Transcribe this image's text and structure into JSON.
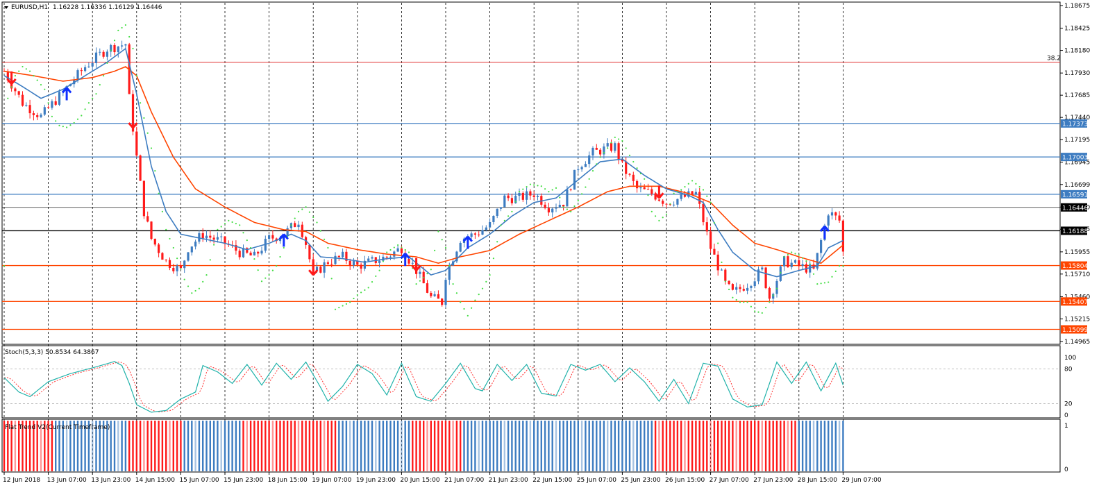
{
  "header": {
    "symbol": "EURUSD,H1",
    "ohlc": "1.16228 1.16336 1.16129 1.16446"
  },
  "price_axis": {
    "ticks": [
      "1.18675",
      "1.18425",
      "1.18180",
      "1.17930",
      "1.17685",
      "1.17440",
      "1.17195",
      "1.16945",
      "1.16699",
      "1.16450",
      "1.16205",
      "1.15955",
      "1.15710",
      "1.15460",
      "1.15215",
      "1.14965"
    ]
  },
  "levels": [
    {
      "label": "1.17373",
      "price": 1.17373,
      "color": "#3d7cc1",
      "boxed": true
    },
    {
      "label": "1.17003",
      "price": 1.17003,
      "color": "#3d7cc1",
      "boxed": true
    },
    {
      "label": "1.16591",
      "price": 1.16591,
      "color": "#3d7cc1",
      "boxed": true
    },
    {
      "label": "1.16446",
      "price": 1.16446,
      "color": "#000000",
      "boxed": true,
      "current": true
    },
    {
      "label": "1.16188",
      "price": 1.16188,
      "color": "#000000",
      "boxed": true
    },
    {
      "label": "1.15804",
      "price": 1.15804,
      "color": "#ff4500",
      "boxed": true
    },
    {
      "label": "1.15407",
      "price": 1.15407,
      "color": "#ff4500",
      "boxed": true
    },
    {
      "label": "1.15099",
      "price": 1.15099,
      "color": "#ff4500",
      "boxed": true
    }
  ],
  "fib": {
    "label": "38.2",
    "price": 1.1805,
    "color": "#e03030"
  },
  "stoch": {
    "title": "Stoch(5,3,3) 50.8534 64.3867",
    "ticks": [
      "100",
      "80",
      "20",
      "0"
    ]
  },
  "flat_trend": {
    "title": "Flat Trend V2(Current Timeframe)",
    "ticks": [
      "1",
      "0"
    ]
  },
  "time_axis": {
    "labels": [
      "12 Jun 2018",
      "13 Jun 07:00",
      "13 Jun 23:00",
      "14 Jun 15:00",
      "15 Jun 07:00",
      "15 Jun 23:00",
      "18 Jun 15:00",
      "19 Jun 07:00",
      "19 Jun 23:00",
      "20 Jun 15:00",
      "21 Jun 07:00",
      "21 Jun 23:00",
      "22 Jun 15:00",
      "25 Jun 07:00",
      "25 Jun 23:00",
      "26 Jun 15:00",
      "27 Jun 07:00",
      "27 Jun 23:00",
      "28 Jun 15:00",
      "29 Jun 07:00"
    ]
  },
  "colors": {
    "bull": "#3d7cc1",
    "bear": "#ff1a1a",
    "ma_fast": "#3d7cc1",
    "ma_slow": "#ff4500",
    "sar": "#44dd44",
    "stoch_main": "#20b2aa",
    "stoch_signal": "#ff3030",
    "arrow_up": "#1030ff",
    "arrow_down": "#ff1a1a",
    "trend_up": "#3d7cc1",
    "trend_down": "#ff1a1a"
  },
  "chart_data": {
    "type": "candlestick",
    "close_path": [
      [
        0,
        1.1795
      ],
      [
        5,
        1.176
      ],
      [
        10,
        1.1745
      ],
      [
        16,
        1.1772
      ],
      [
        22,
        1.18
      ],
      [
        28,
        1.182
      ],
      [
        33,
        1.1825
      ],
      [
        34,
        1.1765
      ],
      [
        36,
        1.17
      ],
      [
        38,
        1.164
      ],
      [
        40,
        1.161
      ],
      [
        44,
        1.1585
      ],
      [
        48,
        1.1575
      ],
      [
        50,
        1.16
      ],
      [
        54,
        1.1615
      ],
      [
        60,
        1.1605
      ],
      [
        64,
        1.1595
      ],
      [
        68,
        1.159
      ],
      [
        72,
        1.161
      ],
      [
        76,
        1.1615
      ],
      [
        80,
        1.163
      ],
      [
        82,
        1.1605
      ],
      [
        84,
        1.157
      ],
      [
        88,
        1.1585
      ],
      [
        92,
        1.159
      ],
      [
        96,
        1.158
      ],
      [
        100,
        1.1585
      ],
      [
        104,
        1.159
      ],
      [
        108,
        1.16
      ],
      [
        112,
        1.1575
      ],
      [
        116,
        1.1545
      ],
      [
        119,
        1.154
      ],
      [
        120,
        1.157
      ],
      [
        124,
        1.161
      ],
      [
        128,
        1.1615
      ],
      [
        132,
        1.1625
      ],
      [
        136,
        1.1655
      ],
      [
        140,
        1.1655
      ],
      [
        144,
        1.166
      ],
      [
        148,
        1.1645
      ],
      [
        152,
        1.165
      ],
      [
        156,
        1.169
      ],
      [
        160,
        1.1705
      ],
      [
        164,
        1.171
      ],
      [
        166,
        1.1712
      ],
      [
        168,
        1.169
      ],
      [
        172,
        1.1665
      ],
      [
        176,
        1.166
      ],
      [
        180,
        1.165
      ],
      [
        184,
        1.1655
      ],
      [
        188,
        1.166
      ],
      [
        192,
        1.16
      ],
      [
        196,
        1.156
      ],
      [
        198,
        1.155
      ],
      [
        202,
        1.156
      ],
      [
        206,
        1.1575
      ],
      [
        208,
        1.1545
      ],
      [
        212,
        1.1585
      ],
      [
        216,
        1.158
      ],
      [
        220,
        1.1575
      ],
      [
        224,
        1.164
      ],
      [
        227,
        1.163
      ],
      [
        228,
        1.1595
      ]
    ],
    "ma_fast_path": [
      [
        0,
        1.179
      ],
      [
        5,
        1.1778
      ],
      [
        10,
        1.1765
      ],
      [
        16,
        1.1775
      ],
      [
        22,
        1.179
      ],
      [
        28,
        1.1805
      ],
      [
        33,
        1.182
      ],
      [
        36,
        1.177
      ],
      [
        40,
        1.169
      ],
      [
        44,
        1.164
      ],
      [
        48,
        1.1615
      ],
      [
        54,
        1.161
      ],
      [
        60,
        1.1605
      ],
      [
        66,
        1.1598
      ],
      [
        72,
        1.1605
      ],
      [
        78,
        1.1615
      ],
      [
        82,
        1.1608
      ],
      [
        86,
        1.159
      ],
      [
        92,
        1.1588
      ],
      [
        98,
        1.1584
      ],
      [
        104,
        1.1588
      ],
      [
        110,
        1.159
      ],
      [
        116,
        1.157
      ],
      [
        120,
        1.1575
      ],
      [
        126,
        1.16
      ],
      [
        132,
        1.1615
      ],
      [
        138,
        1.1635
      ],
      [
        144,
        1.165
      ],
      [
        150,
        1.1655
      ],
      [
        156,
        1.1675
      ],
      [
        162,
        1.1695
      ],
      [
        168,
        1.1698
      ],
      [
        174,
        1.168
      ],
      [
        180,
        1.1665
      ],
      [
        186,
        1.1658
      ],
      [
        190,
        1.165
      ],
      [
        194,
        1.162
      ],
      [
        198,
        1.1595
      ],
      [
        204,
        1.1575
      ],
      [
        210,
        1.1568
      ],
      [
        216,
        1.1575
      ],
      [
        221,
        1.158
      ],
      [
        224,
        1.16
      ],
      [
        228,
        1.1608
      ]
    ],
    "ma_slow_path": [
      [
        0,
        1.1795
      ],
      [
        8,
        1.179
      ],
      [
        16,
        1.1784
      ],
      [
        24,
        1.1788
      ],
      [
        30,
        1.1795
      ],
      [
        33,
        1.18
      ],
      [
        36,
        1.179
      ],
      [
        40,
        1.175
      ],
      [
        46,
        1.17
      ],
      [
        52,
        1.1665
      ],
      [
        60,
        1.1645
      ],
      [
        68,
        1.1628
      ],
      [
        76,
        1.162
      ],
      [
        82,
        1.1618
      ],
      [
        88,
        1.1605
      ],
      [
        96,
        1.1598
      ],
      [
        104,
        1.1593
      ],
      [
        112,
        1.159
      ],
      [
        118,
        1.1583
      ],
      [
        124,
        1.159
      ],
      [
        132,
        1.1597
      ],
      [
        140,
        1.1615
      ],
      [
        148,
        1.163
      ],
      [
        156,
        1.1645
      ],
      [
        164,
        1.1662
      ],
      [
        170,
        1.1668
      ],
      [
        178,
        1.1668
      ],
      [
        186,
        1.166
      ],
      [
        192,
        1.165
      ],
      [
        198,
        1.1625
      ],
      [
        204,
        1.1605
      ],
      [
        210,
        1.1598
      ],
      [
        216,
        1.159
      ],
      [
        222,
        1.1583
      ],
      [
        228,
        1.1603
      ]
    ],
    "sar_points": [
      [
        1,
        1.1765
      ],
      [
        3,
        1.179
      ],
      [
        5,
        1.18
      ],
      [
        7,
        1.1795
      ],
      [
        9,
        1.1785
      ],
      [
        11,
        1.1775
      ],
      [
        13,
        1.1745
      ],
      [
        15,
        1.1735
      ],
      [
        17,
        1.1733
      ],
      [
        19,
        1.1738
      ],
      [
        21,
        1.1746
      ],
      [
        23,
        1.176
      ],
      [
        25,
        1.177
      ],
      [
        27,
        1.179
      ],
      [
        29,
        1.1818
      ],
      [
        31,
        1.184
      ],
      [
        33,
        1.1846
      ],
      [
        35,
        1.182
      ],
      [
        37,
        1.176
      ],
      [
        40,
        1.171
      ],
      [
        42,
        1.166
      ],
      [
        44,
        1.162
      ],
      [
        46,
        1.16
      ],
      [
        49,
        1.1565
      ],
      [
        51,
        1.155
      ],
      [
        53,
        1.1555
      ],
      [
        55,
        1.157
      ],
      [
        58,
        1.162
      ],
      [
        61,
        1.163
      ],
      [
        64,
        1.1625
      ],
      [
        67,
        1.16
      ],
      [
        70,
        1.1563
      ],
      [
        72,
        1.157
      ],
      [
        74,
        1.158
      ],
      [
        76,
        1.16
      ],
      [
        78,
        1.1625
      ],
      [
        80,
        1.164
      ],
      [
        82,
        1.1645
      ],
      [
        85,
        1.1628
      ],
      [
        88,
        1.16
      ],
      [
        90,
        1.1532
      ],
      [
        92,
        1.1536
      ],
      [
        94,
        1.154
      ],
      [
        96,
        1.1548
      ],
      [
        99,
        1.1556
      ],
      [
        102,
        1.1575
      ],
      [
        104,
        1.1595
      ],
      [
        107,
        1.1603
      ],
      [
        110,
        1.1595
      ],
      [
        112,
        1.156
      ],
      [
        114,
        1.1567
      ],
      [
        116,
        1.1576
      ],
      [
        118,
        1.1618
      ],
      [
        120,
        1.16
      ],
      [
        122,
        1.156
      ],
      [
        124,
        1.154
      ],
      [
        126,
        1.1525
      ],
      [
        128,
        1.1542
      ],
      [
        130,
        1.1555
      ],
      [
        132,
        1.157
      ],
      [
        135,
        1.1625
      ],
      [
        138,
        1.164
      ],
      [
        140,
        1.1662
      ],
      [
        143,
        1.167
      ],
      [
        146,
        1.1668
      ],
      [
        148,
        1.1662
      ],
      [
        150,
        1.1666
      ],
      [
        152,
        1.1645
      ],
      [
        154,
        1.164
      ],
      [
        156,
        1.1652
      ],
      [
        158,
        1.1667
      ],
      [
        160,
        1.1685
      ],
      [
        162,
        1.17
      ],
      [
        164,
        1.171
      ],
      [
        166,
        1.1722
      ],
      [
        168,
        1.1718
      ],
      [
        170,
        1.1702
      ],
      [
        172,
        1.1688
      ],
      [
        174,
        1.1676
      ],
      [
        176,
        1.164
      ],
      [
        178,
        1.163
      ],
      [
        180,
        1.1637
      ],
      [
        182,
        1.166
      ],
      [
        184,
        1.1664
      ],
      [
        187,
        1.1674
      ],
      [
        190,
        1.1664
      ],
      [
        192,
        1.165
      ],
      [
        194,
        1.1605
      ],
      [
        196,
        1.1563
      ],
      [
        198,
        1.1545
      ],
      [
        200,
        1.154
      ],
      [
        202,
        1.154
      ],
      [
        204,
        1.153
      ],
      [
        206,
        1.1528
      ],
      [
        208,
        1.154
      ],
      [
        210,
        1.1555
      ],
      [
        212,
        1.159
      ],
      [
        214,
        1.1595
      ],
      [
        216,
        1.1592
      ],
      [
        219,
        1.1582
      ],
      [
        221,
        1.156
      ],
      [
        224,
        1.1562
      ],
      [
        227,
        1.158
      ]
    ],
    "arrows": [
      {
        "i": 2,
        "dir": "down"
      },
      {
        "i": 17,
        "dir": "up"
      },
      {
        "i": 35,
        "dir": "down"
      },
      {
        "i": 76,
        "dir": "up"
      },
      {
        "i": 84,
        "dir": "down"
      },
      {
        "i": 109,
        "dir": "up"
      },
      {
        "i": 112,
        "dir": "down"
      },
      {
        "i": 126,
        "dir": "up"
      },
      {
        "i": 178,
        "dir": "down"
      },
      {
        "i": 223,
        "dir": "up"
      }
    ],
    "stoch_path": [
      [
        0,
        65
      ],
      [
        4,
        40
      ],
      [
        7,
        32
      ],
      [
        12,
        58
      ],
      [
        18,
        72
      ],
      [
        24,
        82
      ],
      [
        30,
        93
      ],
      [
        32,
        86
      ],
      [
        34,
        55
      ],
      [
        36,
        18
      ],
      [
        40,
        5
      ],
      [
        44,
        8
      ],
      [
        48,
        28
      ],
      [
        52,
        40
      ],
      [
        54,
        86
      ],
      [
        58,
        75
      ],
      [
        62,
        55
      ],
      [
        66,
        88
      ],
      [
        70,
        52
      ],
      [
        74,
        90
      ],
      [
        78,
        62
      ],
      [
        82,
        92
      ],
      [
        86,
        48
      ],
      [
        88,
        24
      ],
      [
        92,
        50
      ],
      [
        96,
        88
      ],
      [
        100,
        72
      ],
      [
        104,
        35
      ],
      [
        108,
        90
      ],
      [
        112,
        32
      ],
      [
        116,
        24
      ],
      [
        120,
        55
      ],
      [
        124,
        90
      ],
      [
        128,
        46
      ],
      [
        130,
        42
      ],
      [
        134,
        88
      ],
      [
        138,
        60
      ],
      [
        142,
        88
      ],
      [
        146,
        38
      ],
      [
        150,
        33
      ],
      [
        154,
        88
      ],
      [
        158,
        78
      ],
      [
        162,
        88
      ],
      [
        166,
        58
      ],
      [
        170,
        82
      ],
      [
        174,
        58
      ],
      [
        178,
        24
      ],
      [
        182,
        62
      ],
      [
        186,
        20
      ],
      [
        190,
        90
      ],
      [
        194,
        85
      ],
      [
        198,
        28
      ],
      [
        202,
        14
      ],
      [
        206,
        18
      ],
      [
        210,
        92
      ],
      [
        214,
        55
      ],
      [
        218,
        92
      ],
      [
        222,
        42
      ],
      [
        226,
        90
      ],
      [
        228,
        52
      ]
    ],
    "trend_segments": [
      [
        0,
        13,
        "down"
      ],
      [
        14,
        33,
        "up"
      ],
      [
        34,
        48,
        "down"
      ],
      [
        49,
        57,
        "up"
      ],
      [
        58,
        64,
        "up"
      ],
      [
        65,
        90,
        "down"
      ],
      [
        91,
        110,
        "up"
      ],
      [
        111,
        124,
        "down"
      ],
      [
        125,
        155,
        "up"
      ],
      [
        156,
        176,
        "up"
      ],
      [
        177,
        186,
        "down"
      ],
      [
        187,
        197,
        "down"
      ],
      [
        198,
        215,
        "down"
      ],
      [
        216,
        228,
        "up"
      ]
    ]
  }
}
